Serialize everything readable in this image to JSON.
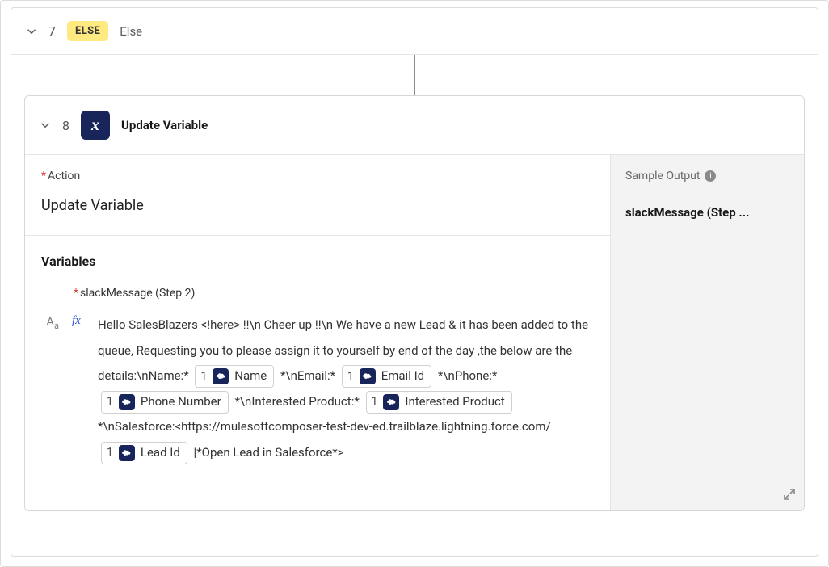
{
  "step7": {
    "number": "7",
    "pill": "ELSE",
    "label": "Else"
  },
  "step8": {
    "number": "8",
    "icon_glyph": "x",
    "title": "Update Variable"
  },
  "action": {
    "label": "Action",
    "value": "Update Variable"
  },
  "sample": {
    "label": "Sample Output",
    "value": "slackMessage (Step ...",
    "placeholder": "_"
  },
  "variables": {
    "heading": "Variables",
    "name": "slackMessage (Step 2)",
    "aa": "Aa",
    "fx": "fx",
    "expr": {
      "t1": "Hello SalesBlazers <!here> !!\\n Cheer up !!\\n We have a new Lead & it has been added to the queue, Requesting you to please assign it to yourself by end of the day ,the below are the details:\\nName:*",
      "chip_name": "Name",
      "t2": "*\\nEmail:*",
      "chip_email": "Email Id",
      "t3": "*\\nPhone:*",
      "chip_phone": "Phone Number",
      "t4": "*\\nInterested Product:*",
      "chip_product": "Interested Product",
      "t5": "*\\nSalesforce:<https://mulesoftcomposer-test-dev-ed.trailblaze.lightning.force.com/",
      "chip_lead": "Lead Id",
      "t6": "|*Open Lead in Salesforce*>",
      "chip_step": "1"
    }
  }
}
